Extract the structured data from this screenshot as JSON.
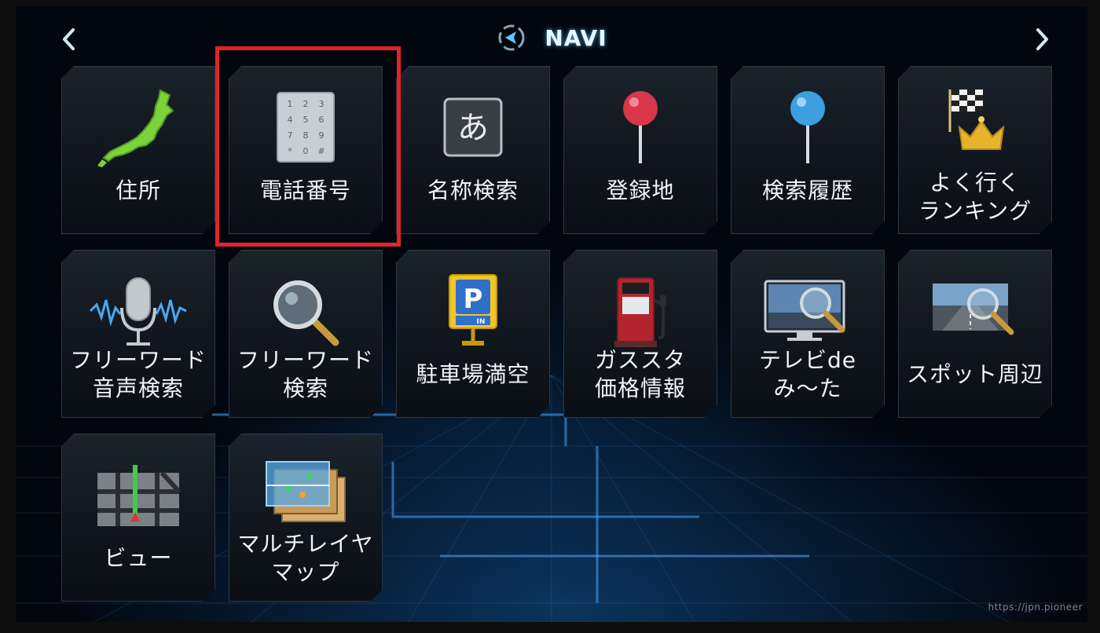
{
  "header": {
    "title": "NAVI",
    "prev_icon": "chevron-left-icon",
    "next_icon": "chevron-right-icon",
    "mode_icon": "navi-mode-icon"
  },
  "menu": {
    "row1": [
      {
        "label": "住所",
        "icon": "japan-map-icon"
      },
      {
        "label": "電話番号",
        "icon": "keypad-icon"
      },
      {
        "label": "名称検索",
        "icon": "hiragana-a-icon"
      },
      {
        "label": "登録地",
        "icon": "red-pin-icon"
      },
      {
        "label": "検索履歴",
        "icon": "blue-pin-icon"
      },
      {
        "label": "よく行く\nランキング",
        "icon": "checkered-flag-crown-icon"
      }
    ],
    "row2": [
      {
        "label": "フリーワード\n音声検索",
        "icon": "microphone-icon"
      },
      {
        "label": "フリーワード\n検索",
        "icon": "magnifier-icon"
      },
      {
        "label": "駐車場満空",
        "icon": "parking-sign-icon"
      },
      {
        "label": "ガススタ\n価格情報",
        "icon": "gas-pump-icon"
      },
      {
        "label": "テレビde\nみ〜た",
        "icon": "tv-magnifier-icon"
      },
      {
        "label": "スポット周辺",
        "icon": "road-magnifier-icon"
      }
    ],
    "row3": [
      {
        "label": "ビュー",
        "icon": "map-view-icon"
      },
      {
        "label": "マルチレイヤ\nマップ",
        "icon": "multi-layer-map-icon"
      }
    ],
    "highlighted": "電話番号"
  },
  "watermark": "https://jpn.pioneer",
  "colors": {
    "highlight": "#e1232a",
    "accent": "#4fb8ff",
    "tile_bg": "#141b23"
  }
}
